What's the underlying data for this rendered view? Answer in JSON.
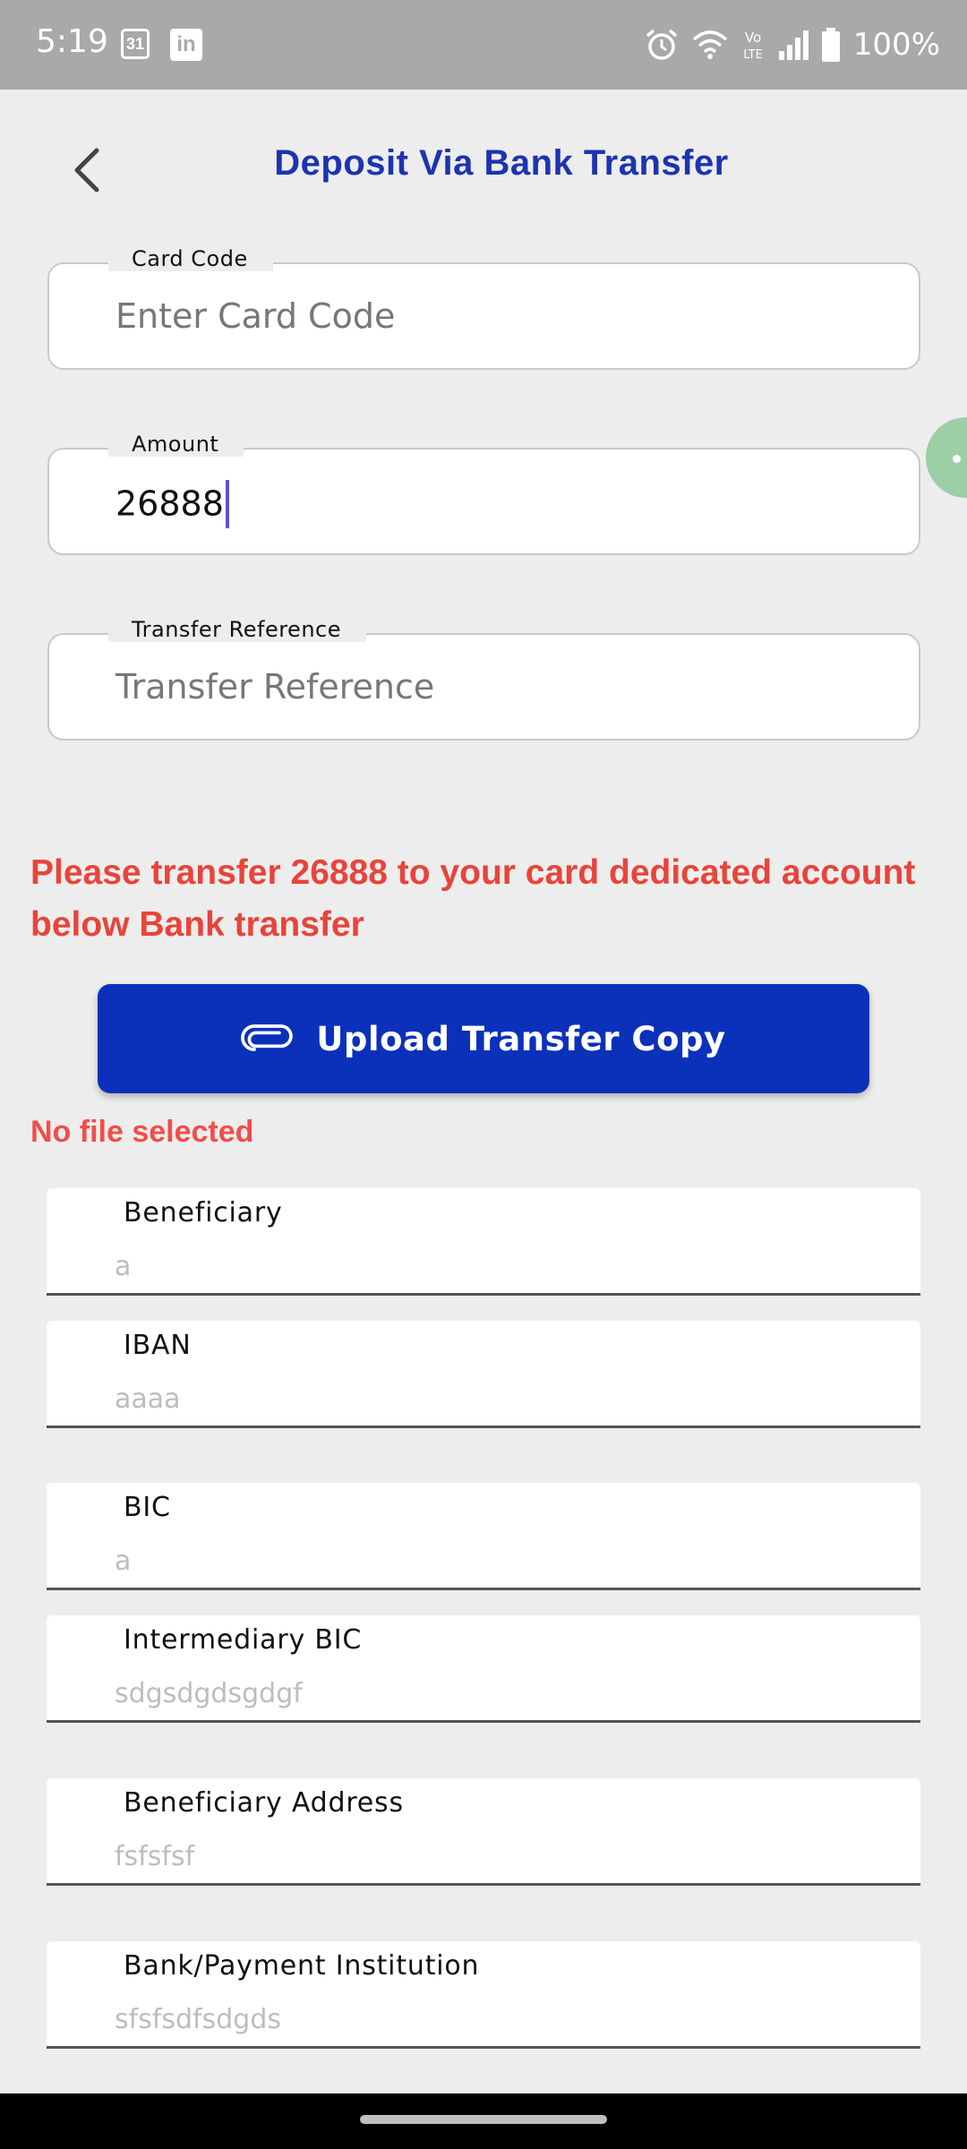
{
  "status_bar": {
    "time": "5:19",
    "calendar_day": "31",
    "linkedin_glyph": "in",
    "volte": "Vo LTE",
    "battery": "100%"
  },
  "header": {
    "title": "Deposit Via Bank Transfer"
  },
  "form": {
    "card_code": {
      "label": "Card Code",
      "placeholder": "Enter Card Code"
    },
    "amount": {
      "label": "Amount",
      "value": "26888"
    },
    "transfer_reference": {
      "label": "Transfer Reference",
      "placeholder": "Transfer Reference"
    }
  },
  "message": "Please transfer 26888 to your card dedicated account below Bank transfer",
  "upload_button": {
    "label": "Upload Transfer Copy"
  },
  "file_status": "No file selected",
  "bank_details": [
    {
      "label": "Beneficiary",
      "value": "a"
    },
    {
      "label": "IBAN",
      "value": "aaaa"
    },
    {
      "label": "BIC",
      "value": "a"
    },
    {
      "label": "Intermediary BIC",
      "value": "sdgsdgdsgdgf"
    },
    {
      "label": "Beneficiary Address",
      "value": "fsfsfsf"
    },
    {
      "label": "Bank/Payment Institution",
      "value": "sfsfsdfsdgds"
    }
  ],
  "colors": {
    "title": "#1c34b0",
    "button": "#0b31bb",
    "error": "#e8443a",
    "fab": "#9ccfa6",
    "status_bar": "#a9a9a9"
  }
}
